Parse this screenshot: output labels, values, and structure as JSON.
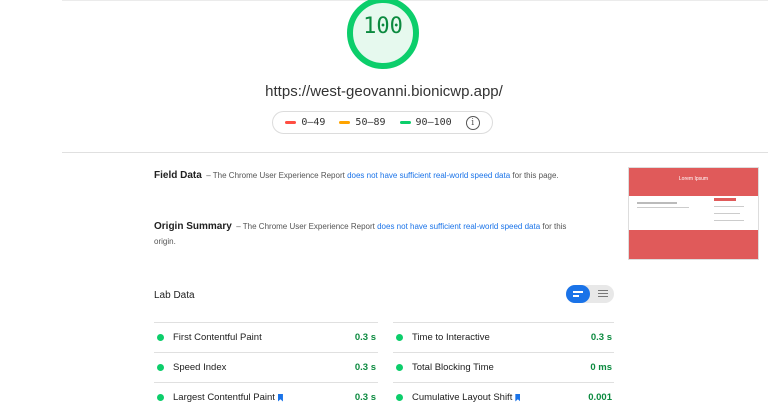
{
  "score": "100",
  "score_color": "#0cce6b",
  "url": "https://west-geovanni.bionicwp.app/",
  "legend": [
    {
      "label": "0–49",
      "color": "#ff4e42"
    },
    {
      "label": "50–89",
      "color": "#ffa400"
    },
    {
      "label": "90–100",
      "color": "#0cce6b"
    }
  ],
  "field_data": {
    "title": "Field Data",
    "dash": "–",
    "text_before": "The Chrome User Experience Report",
    "link": "does not have sufficient real-world speed data",
    "text_after": "for this page."
  },
  "origin_summary": {
    "title": "Origin Summary",
    "dash": "–",
    "text_before": "The Chrome User Experience Report",
    "link": "does not have sufficient real-world speed data",
    "text_after": "for this origin."
  },
  "thumbnail": {
    "header_text": "Lorem Ipsum"
  },
  "lab_data": {
    "title": "Lab Data",
    "metrics": [
      {
        "label": "First Contentful Paint",
        "value": "0.3 s"
      },
      {
        "label": "Time to Interactive",
        "value": "0.3 s"
      },
      {
        "label": "Speed Index",
        "value": "0.3 s"
      },
      {
        "label": "Total Blocking Time",
        "value": "0 ms"
      },
      {
        "label": "Largest Contentful Paint",
        "value": "0.3 s"
      },
      {
        "label": "Cumulative Layout Shift",
        "value": "0.001"
      }
    ]
  }
}
